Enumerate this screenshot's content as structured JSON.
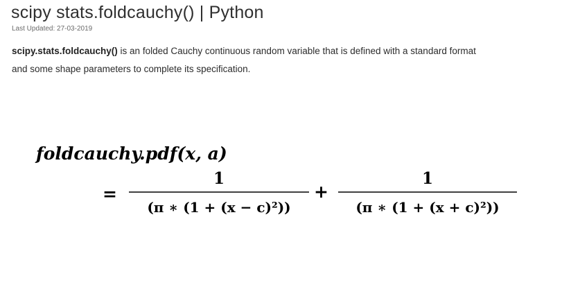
{
  "header": {
    "title": "scipy stats.foldcauchy() | Python",
    "last_updated": "Last Updated: 27-03-2019"
  },
  "content": {
    "code_name": "scipy.stats.foldcauchy()",
    "line1_rest": " is an folded Cauchy continuous random variable that is defined with a standard format",
    "line2": "and some shape parameters to complete its specification."
  },
  "formula": {
    "lhs": "foldcauchy.pdf(x, a)",
    "equals": "=",
    "plus": "+",
    "numerator_1": "1",
    "denominator_1": "(π ∗ (1 +  (x − c)²))",
    "numerator_2": "1",
    "denominator_2": "(π ∗ (1 +  (x + c)²))"
  }
}
